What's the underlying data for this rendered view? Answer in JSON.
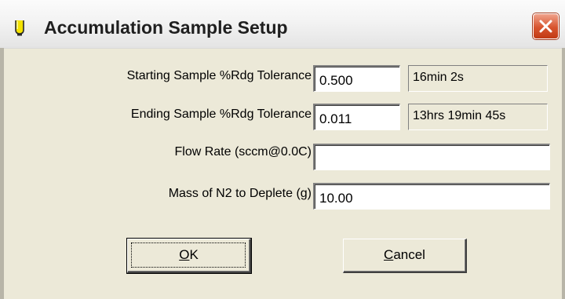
{
  "window": {
    "title": "Accumulation Sample Setup",
    "app_icon": "yellow-lamp-icon",
    "close_icon": "close-icon",
    "accent": "#d8542e"
  },
  "form": {
    "starting_tolerance": {
      "label": "Starting Sample %Rdg Tolerance",
      "value": "0.500",
      "readout": "16min 2s"
    },
    "ending_tolerance": {
      "label": "Ending Sample %Rdg Tolerance",
      "value": "0.011",
      "readout": "13hrs 19min 45s"
    },
    "flow_rate": {
      "label": "Flow Rate (sccm@0.0C)",
      "value": ""
    },
    "mass_n2": {
      "label": "Mass of N2 to Deplete (g)",
      "value": "10.00"
    }
  },
  "buttons": {
    "ok": {
      "mnemonic": "O",
      "rest": "K"
    },
    "cancel": {
      "mnemonic": "C",
      "rest": "ancel"
    }
  }
}
